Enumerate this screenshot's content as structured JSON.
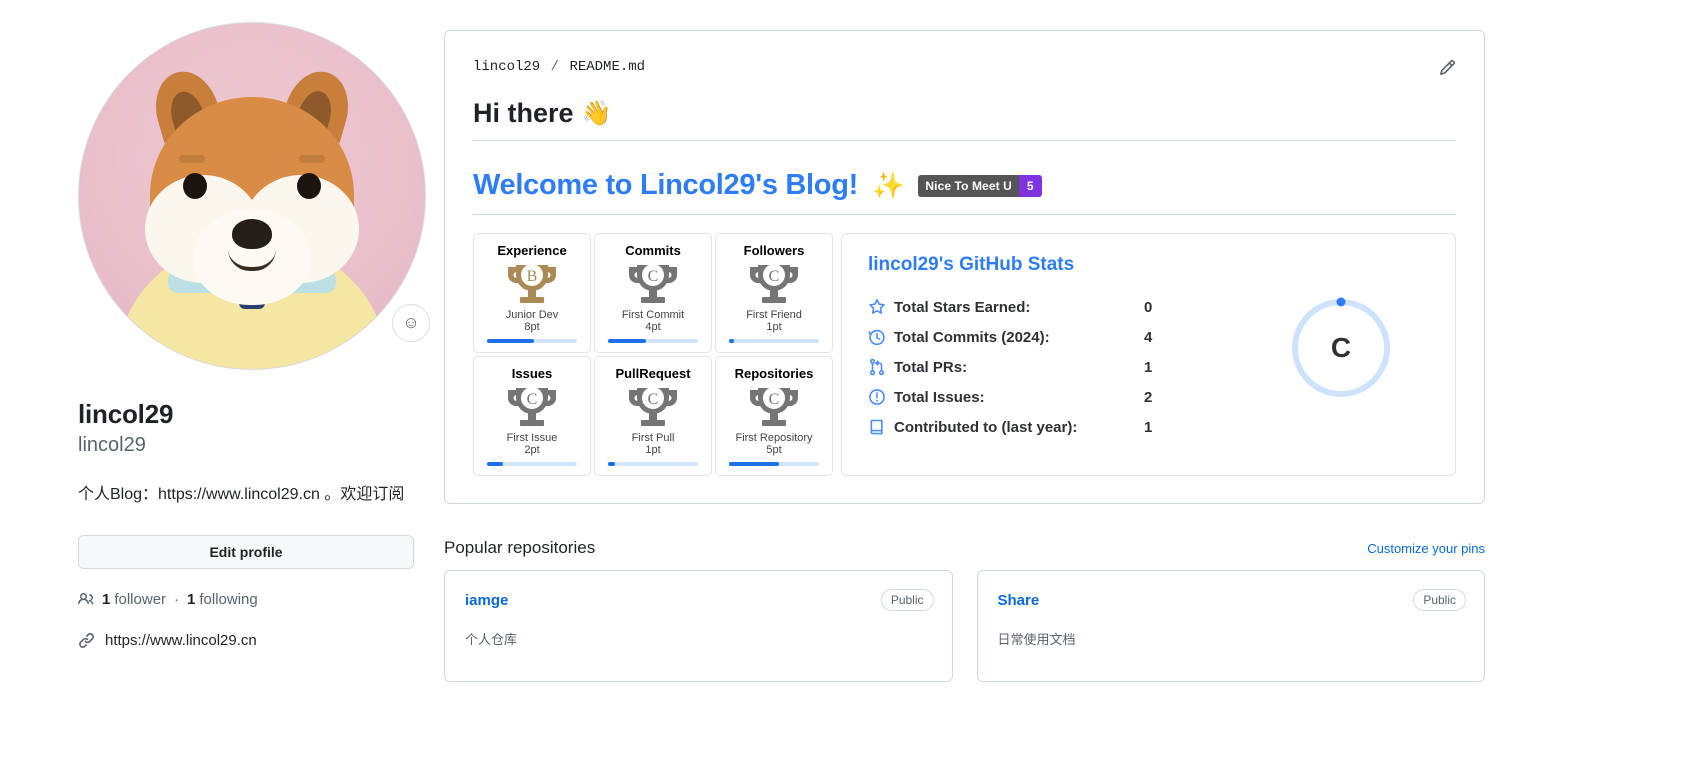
{
  "profile": {
    "avatar_alt": "shiba-inu-avatar",
    "status_emoji": "☺",
    "name": "lincol29",
    "login": "lincol29",
    "bio": "个人Blog：https://www.lincol29.cn 。欢迎订阅",
    "edit_button": "Edit profile",
    "followers_count": "1",
    "followers_label": "follower",
    "separator": "·",
    "following_count": "1",
    "following_label": "following",
    "website": "https://www.lincol29.cn"
  },
  "readme": {
    "breadcrumb_owner": "lincol29",
    "breadcrumb_sep": "/",
    "breadcrumb_file": "README.md",
    "edit_icon": "pencil-icon",
    "heading1": "Hi there",
    "heading1_emoji": "👋",
    "heading2": "Welcome to Lincol29's Blog!",
    "heading2_emoji": "✨",
    "badge_label": "Nice To Meet U",
    "badge_count": "5",
    "badge_left_color": "#555555",
    "badge_right_color": "#8034e0"
  },
  "trophies": [
    {
      "title": "Experience",
      "rank": "B",
      "sub": "Junior Dev",
      "points": "8pt",
      "progress": 52,
      "color": "#ab8b55"
    },
    {
      "title": "Commits",
      "rank": "C",
      "sub": "First Commit",
      "points": "4pt",
      "progress": 42,
      "color": "#757575"
    },
    {
      "title": "Followers",
      "rank": "C",
      "sub": "First Friend",
      "points": "1pt",
      "progress": 6,
      "color": "#757575"
    },
    {
      "title": "Issues",
      "rank": "C",
      "sub": "First Issue",
      "points": "2pt",
      "progress": 18,
      "color": "#757575"
    },
    {
      "title": "PullRequest",
      "rank": "C",
      "sub": "First Pull",
      "points": "1pt",
      "progress": 8,
      "color": "#757575"
    },
    {
      "title": "Repositories",
      "rank": "C",
      "sub": "First Repository",
      "points": "5pt",
      "progress": 55,
      "color": "#757575"
    }
  ],
  "stats": {
    "title": "lincol29's GitHub Stats",
    "rows": [
      {
        "icon": "star-icon",
        "label": "Total Stars Earned:",
        "value": "0"
      },
      {
        "icon": "clock-history-icon",
        "label": "Total Commits (2024):",
        "value": "4"
      },
      {
        "icon": "pull-request-icon",
        "label": "Total PRs:",
        "value": "1"
      },
      {
        "icon": "issue-opened-icon",
        "label": "Total Issues:",
        "value": "2"
      },
      {
        "icon": "repo-icon",
        "label": "Contributed to (last year):",
        "value": "1"
      }
    ],
    "rank_letter": "C",
    "rank_progress": 6,
    "rank_ring_color": "#cfe2fb",
    "rank_dot_color": "#2f7df6"
  },
  "repositories": {
    "section_title": "Popular repositories",
    "customize_link": "Customize your pins",
    "items": [
      {
        "name": "iamge",
        "visibility": "Public",
        "description": "个人仓库"
      },
      {
        "name": "Share",
        "visibility": "Public",
        "description": "日常使用文档"
      }
    ]
  }
}
